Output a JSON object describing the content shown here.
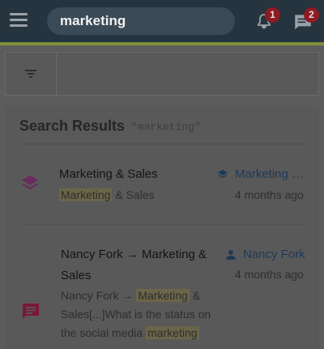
{
  "header": {
    "search_value": "marketing",
    "notifications_count": "1",
    "messages_count": "2"
  },
  "results": {
    "title": "Search Results",
    "query": "\"marketing\""
  },
  "items": [
    {
      "icon": "layers-icon",
      "title": "Marketing & Sales",
      "snippet_highlight": "Marketing",
      "snippet_rest": " & Sales",
      "link_icon": "layers-icon",
      "link_text": "Marketing …",
      "time": "4 months ago"
    },
    {
      "icon": "message-icon",
      "title_line1": "Nancy Fork → Marketing &",
      "title_line2": "Sales",
      "snippet_line1_pre": "Nancy Fork → ",
      "snippet_line1_hl": "Marketing",
      "snippet_line1_post": " &",
      "snippet_line2": "Sales[...]What is the status on",
      "snippet_line3_pre": "the social media ",
      "snippet_line3_hl": "marketing",
      "link_icon": "person-icon",
      "link_text": "Nancy Fork",
      "time": "4 months ago"
    }
  ],
  "colors": {
    "topbar": "#26343f",
    "accent": "#7f8f3a",
    "badge": "#8c1c24",
    "layers_icon": "#6a2c5c",
    "message_icon": "#7a1838",
    "link": "#1c3a58"
  }
}
